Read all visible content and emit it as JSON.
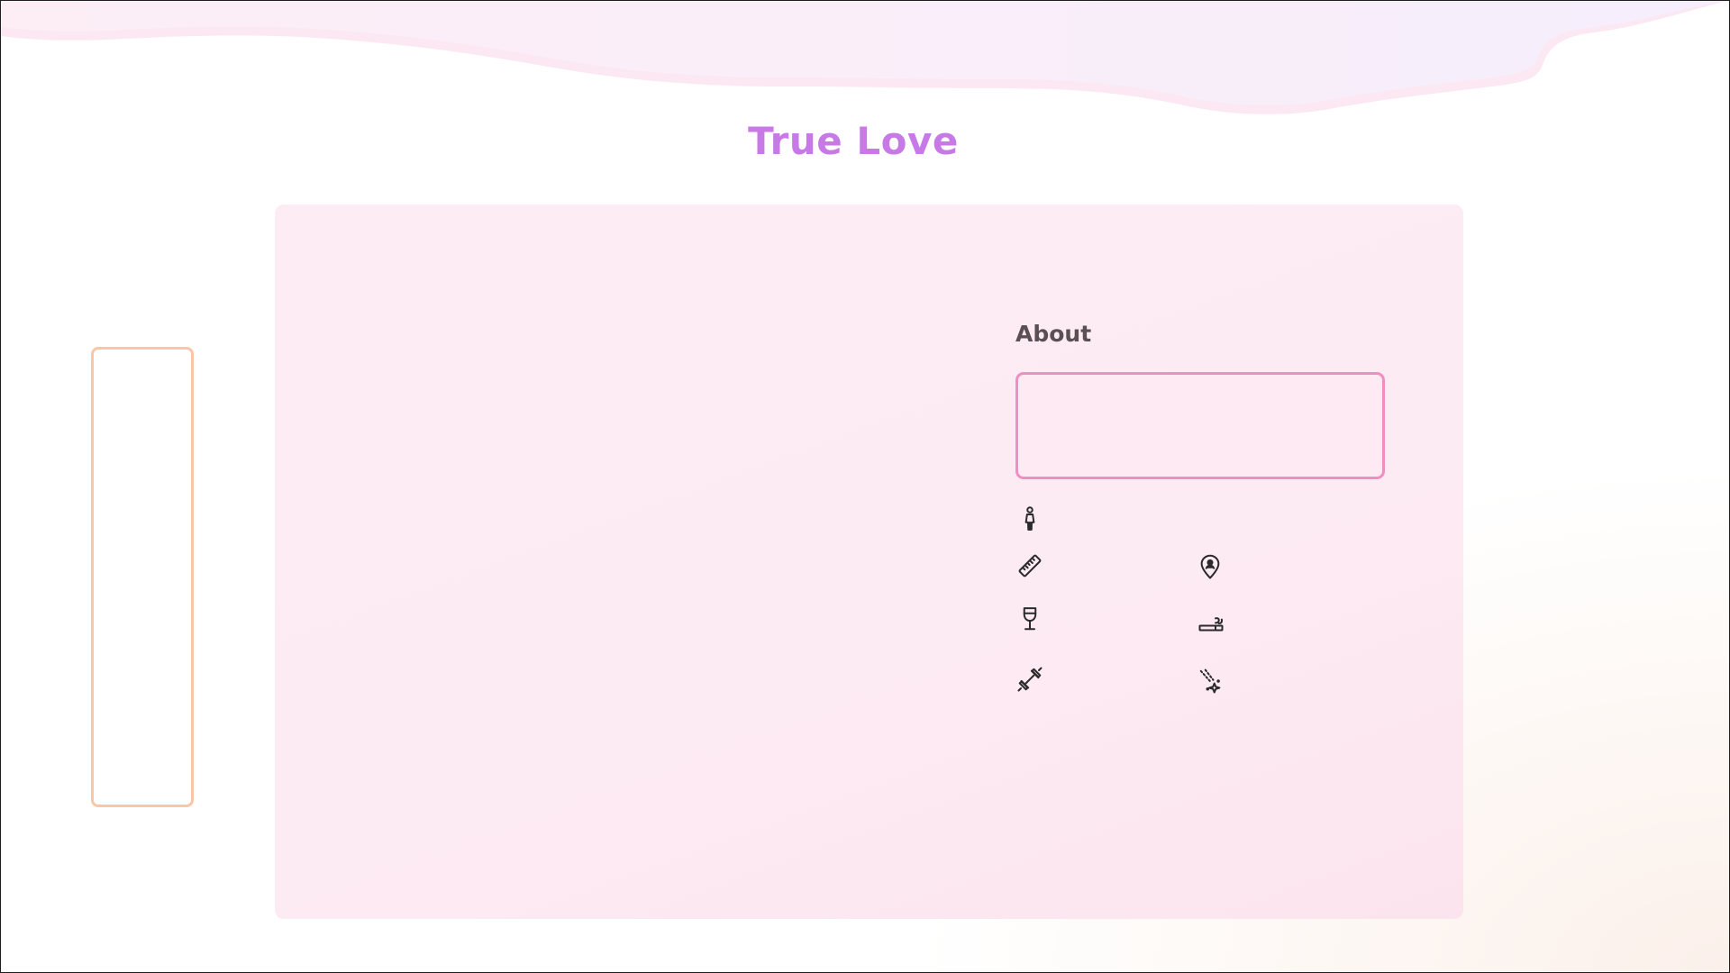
{
  "app": {
    "title": "True Love"
  },
  "about": {
    "heading": "About",
    "text": ""
  },
  "attributes": [
    {
      "icon": "person-icon"
    },
    {
      "icon": "ruler-icon"
    },
    {
      "icon": "location-pin-icon"
    },
    {
      "icon": "wine-glass-icon"
    },
    {
      "icon": "cigarette-icon"
    },
    {
      "icon": "dumbbell-icon"
    },
    {
      "icon": "sparkles-icon"
    }
  ],
  "colors": {
    "title": "#c77ae6",
    "about_border": "#ef8fc1",
    "left_panel_border": "#fbc6a8",
    "card_background": "#fdecf3",
    "heading_text": "#5a5054"
  }
}
